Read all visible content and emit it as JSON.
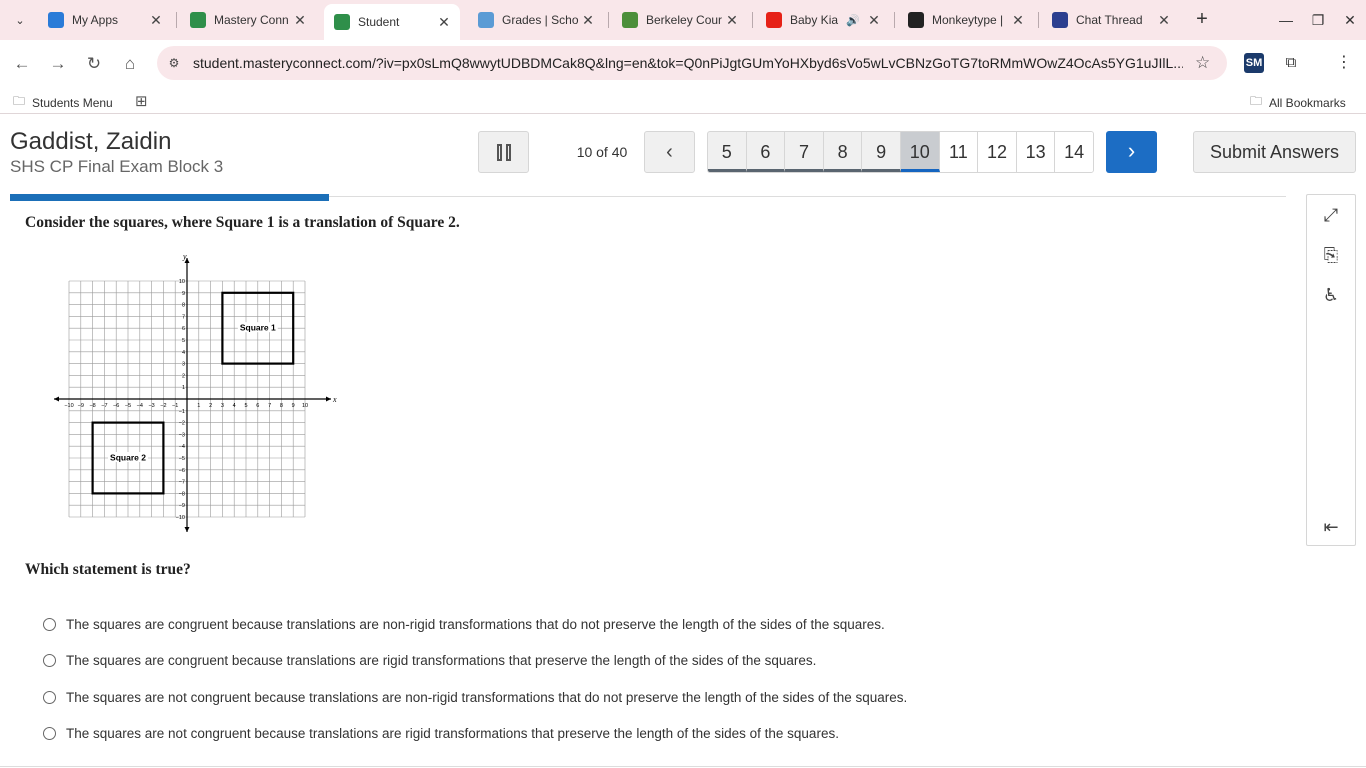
{
  "browser": {
    "tabs": [
      {
        "label": "My Apps",
        "favicon": "my-apps-icon",
        "color": "#2a7bd8"
      },
      {
        "label": "Mastery Conn",
        "favicon": "mastery-connect-icon",
        "color": "#2f8f4a"
      },
      {
        "label": "Student",
        "favicon": "mastery-connect-icon",
        "color": "#2f8f4a"
      },
      {
        "label": "Grades | Scho",
        "favicon": "schoology-icon",
        "color": "#5b9bd5"
      },
      {
        "label": "Berkeley Cour",
        "favicon": "berkeley-icon",
        "color": "#4c8f3a"
      },
      {
        "label": "Baby Kia",
        "favicon": "youtube-icon",
        "color": "#e62117"
      },
      {
        "label": "Monkeytype |",
        "favicon": "monkeytype-icon",
        "color": "#222222"
      },
      {
        "label": "Chat Thread",
        "favicon": "chat-icon",
        "color": "#2c3e8f"
      }
    ],
    "active_tab_index": 2,
    "url": "student.masteryconnect.com/?iv=px0sLmQ8wwytUDBDMCak8Q&lng=en&tok=Q0nPiJgtGUmYoHXbyd6sVo5wLvCBNzGoTG7toRMmWOwZ4OcAs5YG1uJIlL...",
    "bookmarks": {
      "left": "Students Menu",
      "right": "All Bookmarks"
    }
  },
  "header": {
    "student_name": "Gaddist, Zaidin",
    "exam_name": "SHS CP Final Exam Block 3",
    "progress_text": "10 of 40",
    "question_numbers": [
      "5",
      "6",
      "7",
      "8",
      "9",
      "10",
      "11",
      "12",
      "13",
      "14"
    ],
    "current_question": "10",
    "submit_label": "Submit Answers",
    "progress_fraction": 0.25
  },
  "question": {
    "stem": "Consider the squares, where Square 1 is a translation of Square 2.",
    "prompt": "Which statement is true?",
    "choices": [
      "The squares are congruent because translations are non-rigid transformations that do not preserve the length of the sides of the squares.",
      "The squares are congruent because translations are rigid transformations that preserve the length of the sides of the squares.",
      "The squares are not congruent because translations are non-rigid transformations that do not preserve the length of the sides of the squares.",
      "The squares are not congruent because translations are rigid transformations that preserve the length of the sides of the squares."
    ]
  },
  "graph": {
    "x_axis_label": "x",
    "y_axis_label": "y",
    "range": [
      -10,
      10
    ],
    "square_1": {
      "label": "Square 1",
      "corners": [
        [
          3,
          3
        ],
        [
          9,
          9
        ]
      ]
    },
    "square_2": {
      "label": "Square 2",
      "corners": [
        [
          -8,
          -8
        ],
        [
          -2,
          -2
        ]
      ]
    }
  },
  "tools": [
    "expand-icon",
    "line-reader-icon",
    "accessibility-icon",
    "collapse-panel-icon"
  ]
}
